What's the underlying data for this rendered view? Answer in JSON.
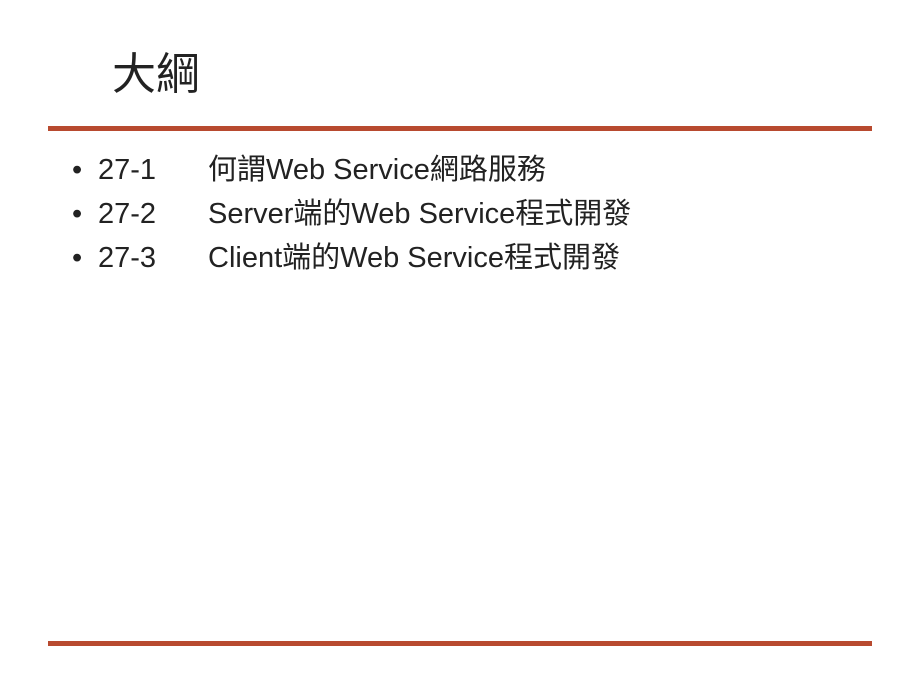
{
  "slide": {
    "title": "大綱",
    "items": [
      {
        "number": "27-1",
        "text": "何謂Web Service網路服務"
      },
      {
        "number": "27-2",
        "text": "Server端的Web Service程式開發"
      },
      {
        "number": "27-3",
        "text": "Client端的Web Service程式開發"
      }
    ]
  }
}
